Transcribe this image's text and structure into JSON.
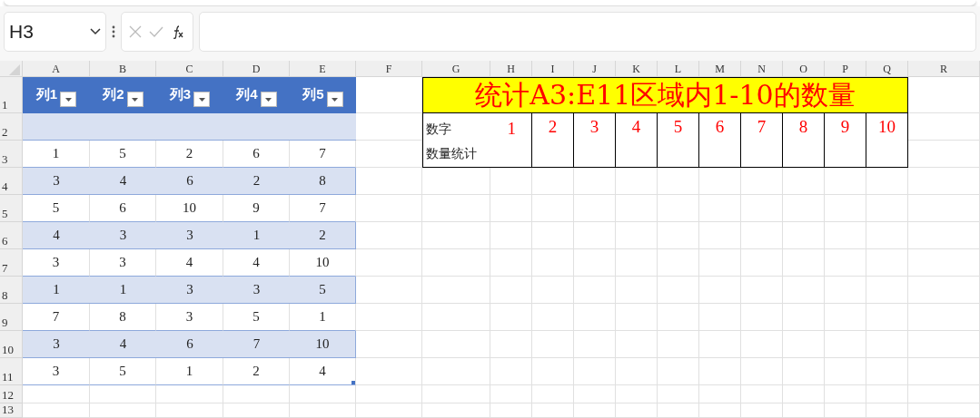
{
  "name_box": {
    "value": "H3"
  },
  "columns": [
    "A",
    "B",
    "C",
    "D",
    "E",
    "F",
    "G",
    "H",
    "I",
    "J",
    "K",
    "L",
    "M",
    "N",
    "O",
    "P",
    "Q",
    "R"
  ],
  "row_numbers": [
    "1",
    "2",
    "3",
    "4",
    "5",
    "6",
    "7",
    "8",
    "9",
    "10",
    "11",
    "12",
    "13"
  ],
  "table": {
    "headers": [
      "列1",
      "列2",
      "列3",
      "列4",
      "列5"
    ],
    "rows": [
      [
        "1",
        "5",
        "2",
        "6",
        "7"
      ],
      [
        "3",
        "4",
        "6",
        "2",
        "8"
      ],
      [
        "5",
        "6",
        "10",
        "9",
        "7"
      ],
      [
        "4",
        "3",
        "3",
        "1",
        "2"
      ],
      [
        "3",
        "3",
        "4",
        "4",
        "10"
      ],
      [
        "1",
        "1",
        "3",
        "3",
        "5"
      ],
      [
        "7",
        "8",
        "3",
        "5",
        "1"
      ],
      [
        "3",
        "4",
        "6",
        "7",
        "10"
      ],
      [
        "3",
        "5",
        "1",
        "2",
        "4"
      ]
    ]
  },
  "summary": {
    "title": "统计A3:E11区域内1-10的数量",
    "row_labels": [
      "数字",
      "数量统计"
    ],
    "numbers": [
      "1",
      "2",
      "3",
      "4",
      "5",
      "6",
      "7",
      "8",
      "9",
      "10"
    ]
  }
}
